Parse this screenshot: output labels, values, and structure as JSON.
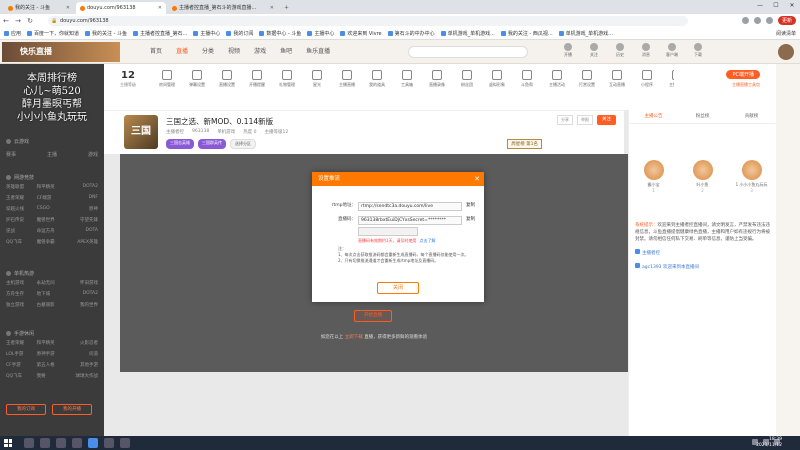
{
  "browser": {
    "tabs": [
      {
        "label": "我的关注 - 斗鱼",
        "active": false
      },
      {
        "label": "douyu.com/963138",
        "active": true
      },
      {
        "label": "主播者控直播_第石斗的游戏直播...",
        "active": false
      }
    ],
    "url": "douyu.com/963138",
    "update_label": "更新",
    "bookmarks": [
      "应用",
      "百度一下，你就知道",
      "我的关注 - 斗鱼",
      "主播者控直播_第石...",
      "主播中心",
      "我的订阅",
      "数据中心 - 斗鱼",
      "主播中心",
      "欢迎来到 Vivre",
      "第石斗的中办中心",
      "单机游戏_单机游戏...",
      "我的关注 - 西瓜视...",
      "单机游戏_单机游戏..."
    ],
    "bookmarks_right": "阅读清单"
  },
  "douyu": {
    "logo": "快乐直播",
    "nav": [
      "首页",
      "直播",
      "分类",
      "视频",
      "游戏",
      "鱼吧",
      "鱼乐直播"
    ],
    "nav_active": 1,
    "user_icons": [
      "开播",
      "关注",
      "历史",
      "消息",
      "客户端",
      "下载"
    ]
  },
  "sidebar": {
    "rank_lines": [
      "本周排行榜",
      "心儿~萌520",
      "醉月墨暝丐帮",
      "小小小鱼丸玩玩"
    ],
    "row1": [
      "云游戏",
      ""
    ],
    "row2": [
      "赛事",
      "主播",
      "游戏"
    ],
    "section1_title": "网游竞技",
    "section1_items": [
      "英雄联盟",
      "和平精英",
      "DOTA2",
      "王者荣耀",
      "CF端游",
      "DNF",
      "穿越火线",
      "CSGO",
      "原神",
      "炉石传说",
      "魔兽世界",
      "守望先锋",
      "逆战",
      "命运方舟",
      "DOTA",
      "QQ飞车",
      "魔兽争霸",
      "APEX英雄"
    ],
    "section2_title": "单机热游",
    "section2_items": [
      "主机游戏",
      "永劫无间",
      "怀旧游戏",
      "方舟生存",
      "地下城",
      "DOTA2",
      "独立游戏",
      "古墓丽影",
      "我的世界"
    ],
    "section3_title": "手游休闲",
    "section3_items": [
      "王者荣耀",
      "和平精英",
      "火影忍者",
      "LOL手游",
      "原神手游",
      "问道",
      "CF手游",
      "第五人格",
      "其他手游",
      "QQ飞车",
      "我要",
      "球球大作战"
    ],
    "btn_left": "我的订阅",
    "btn_right": "我的开播"
  },
  "room_top": {
    "level": "12",
    "level_label": "主播等级",
    "tools": [
      "房间管理",
      "弹幕设置",
      "直播设置",
      "开播提醒",
      "礼物管理",
      "星光",
      "主播直播",
      "我的道具",
      "工具箱",
      "直播录像",
      "粉丝团",
      "虚拟形象",
      "斗鱼帮",
      "主播活动",
      "打赏设置",
      "互动直播",
      "小程序",
      "主播任务"
    ],
    "pc_button": "PC端开播",
    "pc_sub": "主播直播工具包"
  },
  "room": {
    "avatar_text": "三国",
    "title": "三国之选、新MOD、0.114新版",
    "meta": [
      "主播者控",
      "963138",
      "单机游戏",
      "热度 0",
      "主播等级12"
    ],
    "tags": [
      "三国志英雄",
      "三国群英传",
      "选择分区"
    ],
    "share": "分享",
    "report": "举报",
    "follow": "关注",
    "week_badge": "周星榜 第1名"
  },
  "video": {
    "start_button": "开始直播",
    "hint_prefix": "如您在以上",
    "hint_highlight": "立即下载",
    "hint_suffix": "直播，获得更多新鲜的观看体验"
  },
  "dialog": {
    "title": "设置推流",
    "rtmp_label": "rtmp地址：",
    "rtmp_value": "rtmp://sendtc3a.douyu.com/live",
    "copy_label": "复制",
    "code_label": "直播码：",
    "code_value": "963138rbxtEuiDjCYxsSecret=********",
    "code_select_value": "",
    "key_hint": "直播码有效期约1天，请及时使用",
    "key_link": "点击了解",
    "notes_title": "注：",
    "notes": [
      "1、每次点击获取推流码都会重新生成直播码，每个直播码仅能使用一次。",
      "2、只有切换推流通道才会重新生成rtmp地址及直播码。"
    ],
    "ok_button": "关闭"
  },
  "right_panel": {
    "tabs": [
      "主播公告",
      "粉丝榜",
      "贡献榜"
    ],
    "tab_active": 0,
    "fans": [
      {
        "name": "霸小宝",
        "value": "1"
      },
      {
        "name": "叶小鱼",
        "value": "2"
      },
      {
        "name": "1 小小小鱼丸玩玩",
        "value": "3"
      }
    ],
    "chat_system": "系统提示：",
    "chat_text": "欢迎来到主播者控直播间，请文明发言，严禁发布违法违规信息，斗鱼直播提倡健康绿色直播，主播和用户如有违规行为将被封禁。请勿相信任何私下交易、刷单等信息，谨防上当受骗。",
    "chat_lines": [
      "主播者控",
      "agc1393 欢迎来到本直播间"
    ]
  },
  "taskbar": {
    "time": "18:39",
    "date": "2021/11/12"
  }
}
